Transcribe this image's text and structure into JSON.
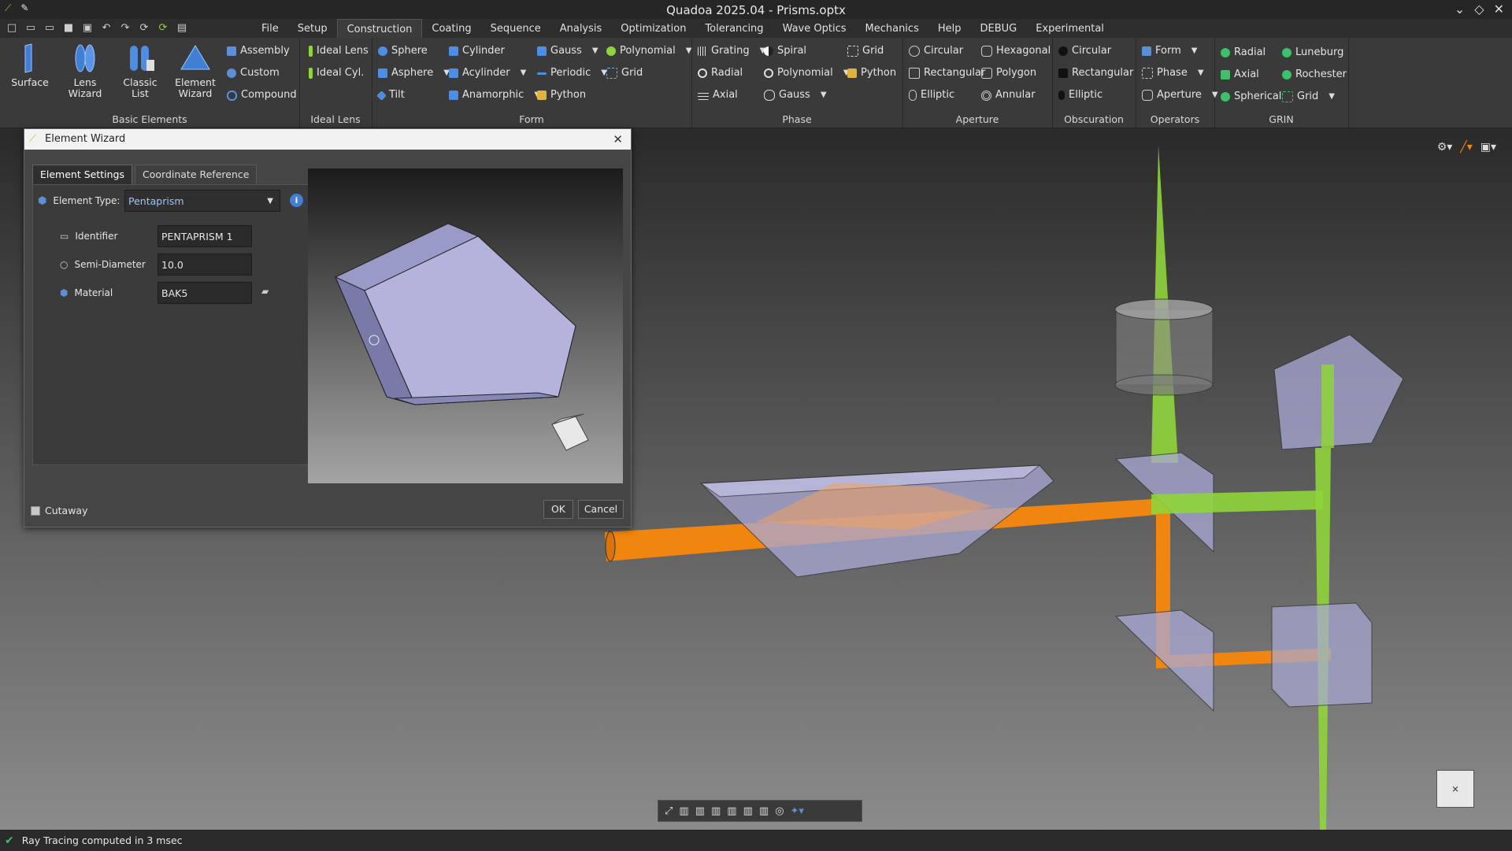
{
  "window": {
    "title": "Quadoa 2025.04 - Prisms.optx"
  },
  "menu": [
    "File",
    "Setup",
    "Construction",
    "Coating",
    "Sequence",
    "Analysis",
    "Optimization",
    "Tolerancing",
    "Wave Optics",
    "Mechanics",
    "Help",
    "DEBUG",
    "Experimental"
  ],
  "ribbon": {
    "basic_elements": {
      "label": "Basic Elements",
      "surface": "Surface",
      "lens_wizard_1": "Lens",
      "lens_wizard_2": "Wizard",
      "classic_1": "Classic",
      "classic_2": "List",
      "element_1": "Element",
      "element_2": "Wizard",
      "assembly": "Assembly",
      "custom": "Custom",
      "compound": "Compound"
    },
    "ideal_lens": {
      "label": "Ideal Lens",
      "ideal_lens": "Ideal Lens",
      "ideal_cyl": "Ideal Cyl."
    },
    "form": {
      "label": "Form",
      "sphere": "Sphere",
      "asphere": "Asphere",
      "tilt": "Tilt",
      "cylinder": "Cylinder",
      "acylinder": "Acylinder",
      "anamorphic": "Anamorphic",
      "gauss": "Gauss",
      "periodic": "Periodic",
      "python": "Python",
      "polynomial": "Polynomial",
      "grid": "Grid"
    },
    "phase": {
      "label": "Phase",
      "grating": "Grating",
      "radial": "Radial",
      "axial": "Axial",
      "spiral": "Spiral",
      "polynomial": "Polynomial",
      "gauss": "Gauss",
      "grid": "Grid",
      "python": "Python"
    },
    "aperture": {
      "label": "Aperture",
      "circular": "Circular",
      "rectangular": "Rectangular",
      "elliptic": "Elliptic",
      "hexagonal": "Hexagonal",
      "polygon": "Polygon",
      "annular": "Annular"
    },
    "obscuration": {
      "label": "Obscuration",
      "circular": "Circular",
      "rectangular": "Rectangular",
      "elliptic": "Elliptic"
    },
    "operators": {
      "label": "Operators",
      "form": "Form",
      "phase": "Phase",
      "aperture": "Aperture"
    },
    "grin": {
      "label": "GRIN",
      "radial": "Radial",
      "axial": "Axial",
      "spherical": "Spherical",
      "luneburg": "Luneburg",
      "rochester": "Rochester",
      "grid": "Grid"
    }
  },
  "dialog": {
    "title": "Element Wizard",
    "tabs": [
      "Element Settings",
      "Coordinate Reference"
    ],
    "element_type_label": "Element Type:",
    "element_type_value": "Pentaprism",
    "identifier_label": "Identifier",
    "identifier_value": "PENTAPRISM 1",
    "semi_diameter_label": "Semi-Diameter",
    "semi_diameter_value": "10.0",
    "material_label": "Material",
    "material_value": "BAK5",
    "cutaway_label": "Cutaway",
    "ok": "OK",
    "cancel": "Cancel"
  },
  "status": {
    "message": "Ray Tracing computed in 3 msec"
  },
  "colors": {
    "ribbon_bg": "#3a3a3a",
    "beam_orange": "#f0850f",
    "beam_green": "#8fd43a",
    "prism_glass": "#a9a9d6"
  }
}
